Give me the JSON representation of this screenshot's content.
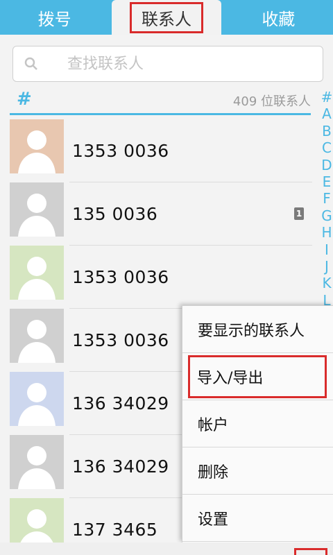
{
  "tabs": [
    {
      "label": "拨号"
    },
    {
      "label": "联系人"
    },
    {
      "label": "收藏"
    }
  ],
  "search": {
    "placeholder": "查找联系人"
  },
  "section": {
    "symbol": "#",
    "count": "409 位联系人"
  },
  "contacts": [
    {
      "name": "1353   0036",
      "avatar_color": "#e8c7b0"
    },
    {
      "name": "135    0036",
      "avatar_color": "#d0d0d0"
    },
    {
      "name": "1353   0036",
      "avatar_color": "#d6e6c1"
    },
    {
      "name": "1353   0036",
      "avatar_color": "#d0d0d0"
    },
    {
      "name": "136   34029",
      "avatar_color": "#cdd7ee"
    },
    {
      "name": "136   34029",
      "avatar_color": "#d0d0d0"
    },
    {
      "name": "137   3465",
      "avatar_color": "#d6e6c1"
    }
  ],
  "sim_badge": "1",
  "alpha_index": [
    "#",
    "A",
    "B",
    "C",
    "D",
    "E",
    "F",
    "G",
    "H",
    "I",
    "J",
    "K",
    "L"
  ],
  "menu": [
    {
      "label": "要显示的联系人"
    },
    {
      "label": "导入/导出"
    },
    {
      "label": "帐户"
    },
    {
      "label": "删除"
    },
    {
      "label": "设置"
    }
  ],
  "colors": {
    "accent": "#4bb8e3",
    "highlight": "#d92b2b"
  }
}
